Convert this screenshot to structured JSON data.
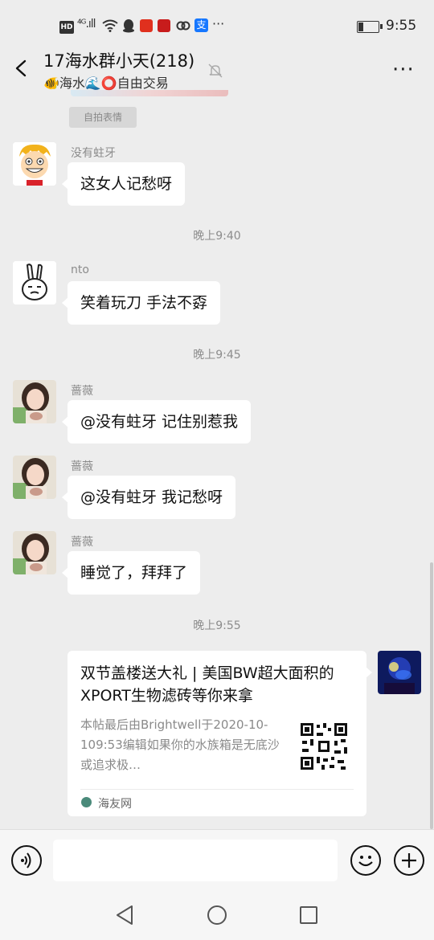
{
  "status_bar": {
    "hd": "HD",
    "signal": "⁴ᴳ.ıll",
    "time": "9:55",
    "more": "···"
  },
  "header": {
    "title": "17海水群小天(218)",
    "subtitle": "🐠海水🌊⭕自由交易",
    "more_label": "···"
  },
  "messages": {
    "sticker_tag": "自拍表情",
    "m1": {
      "sender": "没有蛀牙",
      "text": "这女人记愁呀"
    },
    "t1": "晚上9:40",
    "m2": {
      "sender": "nto",
      "text": "笑着玩刀  手法不孬"
    },
    "t2": "晚上9:45",
    "m3": {
      "sender": "蔷薇",
      "text": "@没有蛀牙  记住别惹我"
    },
    "m4": {
      "sender": "蔷薇",
      "text": "@没有蛀牙  我记愁呀"
    },
    "m5": {
      "sender": "蔷薇",
      "text": "睡觉了，拜拜了"
    },
    "t3": "晚上9:55",
    "card": {
      "title": "双节盖楼送大礼 | 美国BW超大面积的XPORT生物滤砖等你来拿",
      "desc": "本帖最后由Brightwell于2020-10-109:53编辑如果你的水族箱是无底沙或追求极…",
      "source": "海友网"
    }
  },
  "input": {
    "value": "",
    "placeholder": ""
  }
}
